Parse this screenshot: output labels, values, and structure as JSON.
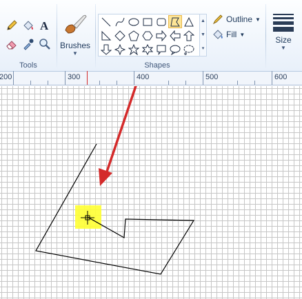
{
  "ribbon": {
    "tools_group": {
      "label": "Tools",
      "buttons": [
        "pencil-icon",
        "fill-icon",
        "text-icon",
        "eraser-icon",
        "color-picker-icon",
        "magnifier-icon"
      ]
    },
    "brushes": {
      "label": "Brushes"
    },
    "shapes_group": {
      "label": "Shapes",
      "selected": "polygon-icon"
    },
    "outline": {
      "label": "Outline"
    },
    "fill": {
      "label": "Fill"
    },
    "size": {
      "label": "Size"
    }
  },
  "ruler": {
    "labels": [
      "200",
      "300",
      "400",
      "500",
      "600"
    ]
  },
  "colors": {
    "highlight": "#ffff33",
    "arrow": "#d42a2a",
    "selected_shape": "#fde596"
  }
}
